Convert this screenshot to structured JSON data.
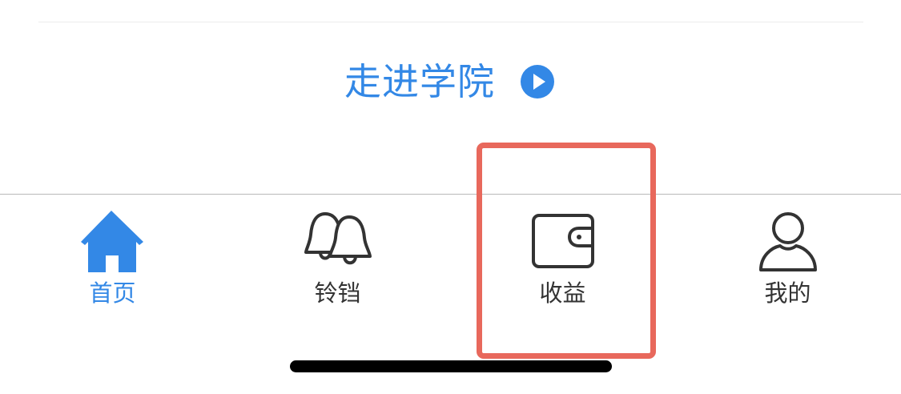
{
  "academy": {
    "label": "走进学院"
  },
  "tabbar": {
    "tabs": [
      {
        "label": "首页",
        "icon": "home-icon",
        "active": true
      },
      {
        "label": "铃铛",
        "icon": "bell-icon",
        "active": false
      },
      {
        "label": "收益",
        "icon": "wallet-icon",
        "active": false
      },
      {
        "label": "我的",
        "icon": "person-icon",
        "active": false
      }
    ]
  },
  "colors": {
    "accent": "#3388e6",
    "highlight": "#e8685c",
    "text": "#333333",
    "divider": "#b9b9b9"
  }
}
